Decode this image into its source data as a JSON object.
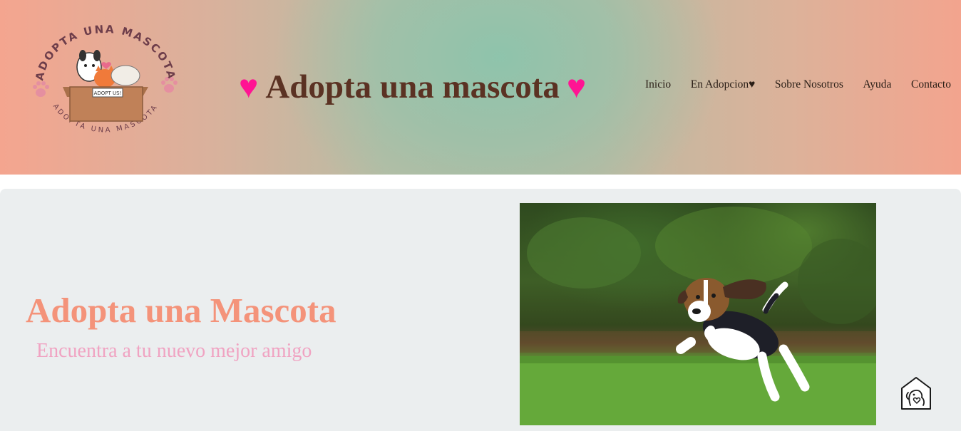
{
  "header": {
    "logo": {
      "ring_text_top": "ADOPTA UNA MASCOTA",
      "ring_text_bottom": "ADOPTA UNA MASCOTA",
      "box_text": "ADOPT US!"
    },
    "title": "Adopta una mascota",
    "heart_left": "♥",
    "heart_right": "♥"
  },
  "nav": {
    "items": [
      {
        "label": "Inicio"
      },
      {
        "label": "En Adopcion♥"
      },
      {
        "label": "Sobre Nosotros"
      },
      {
        "label": "Ayuda"
      },
      {
        "label": "Contacto"
      }
    ]
  },
  "hero": {
    "title": "Adopta una Mascota",
    "subtitle": "Encuentra a tu nuevo mejor amigo"
  },
  "colors": {
    "title_brown": "#5b3223",
    "heart_pink": "#ff1493",
    "hero_title": "#f4937a",
    "hero_subtitle": "#f0a3c2",
    "header_peach": "#f4a58f",
    "header_teal": "#8cc4ac"
  },
  "icons": {
    "floating_button": "pet-home-icon"
  }
}
